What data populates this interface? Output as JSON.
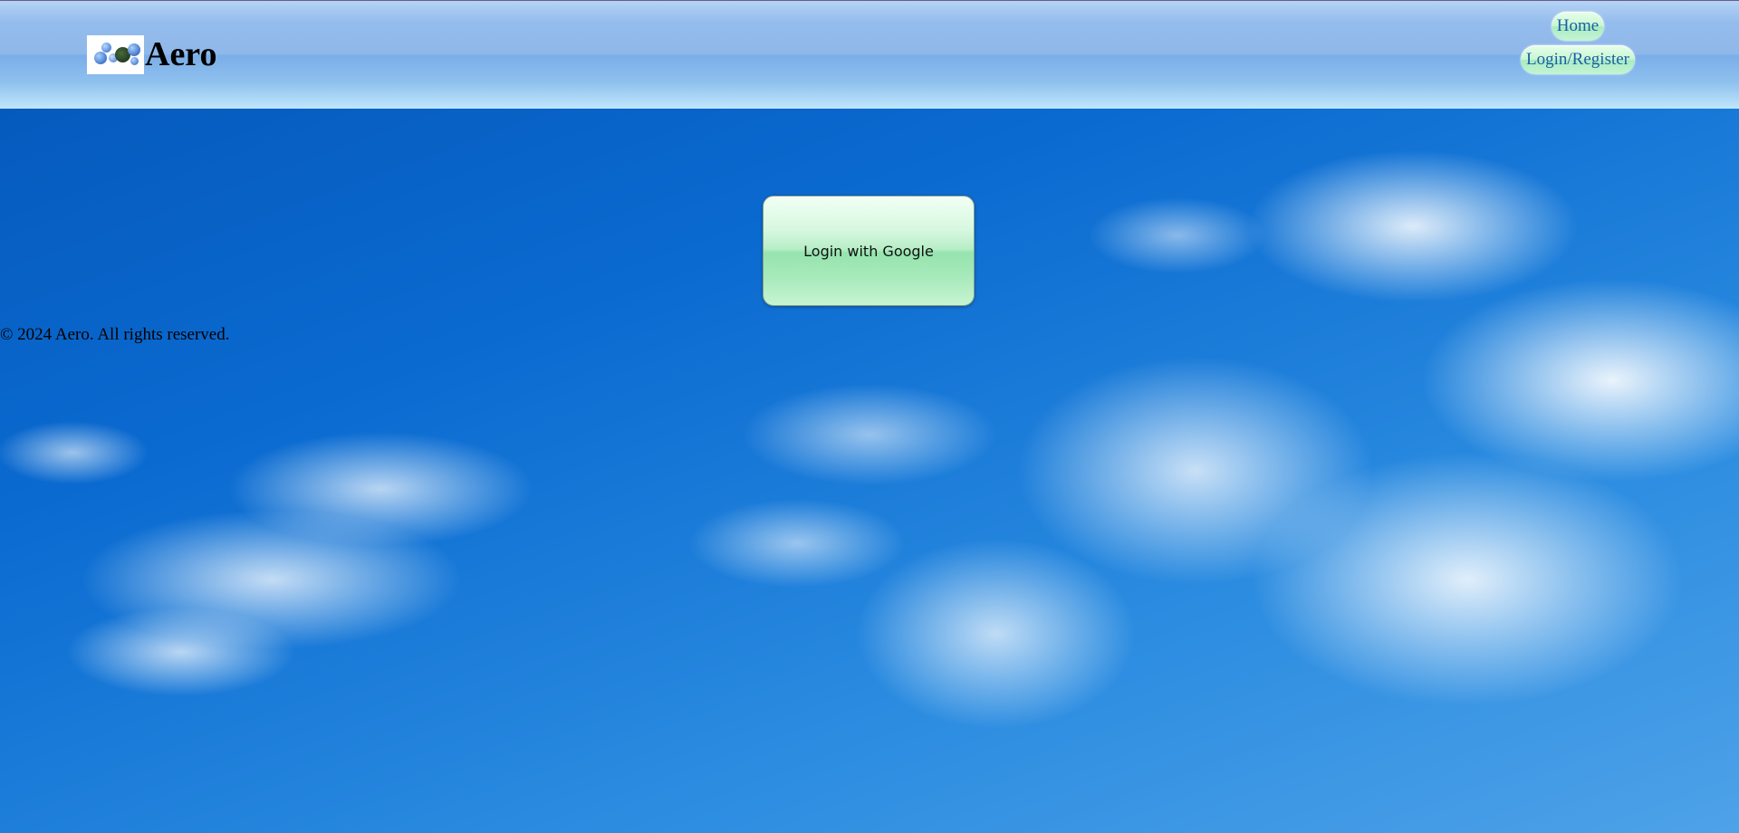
{
  "header": {
    "brand_name": "Aero",
    "logo_icon": "aero-bubbles-logo"
  },
  "nav": {
    "items": [
      {
        "label": "Home"
      },
      {
        "label": "Login/Register"
      }
    ]
  },
  "main": {
    "login_button_label": "Login with Google"
  },
  "footer": {
    "copyright": "© 2024 Aero. All rights reserved."
  },
  "colors": {
    "header_gradient_top": "#b5d4f5",
    "header_gradient_bottom": "#bfe6fb",
    "pill_green": "#c9f6d2",
    "nav_text": "#1a5fa8",
    "sky_blue": "#0a6ad0"
  }
}
